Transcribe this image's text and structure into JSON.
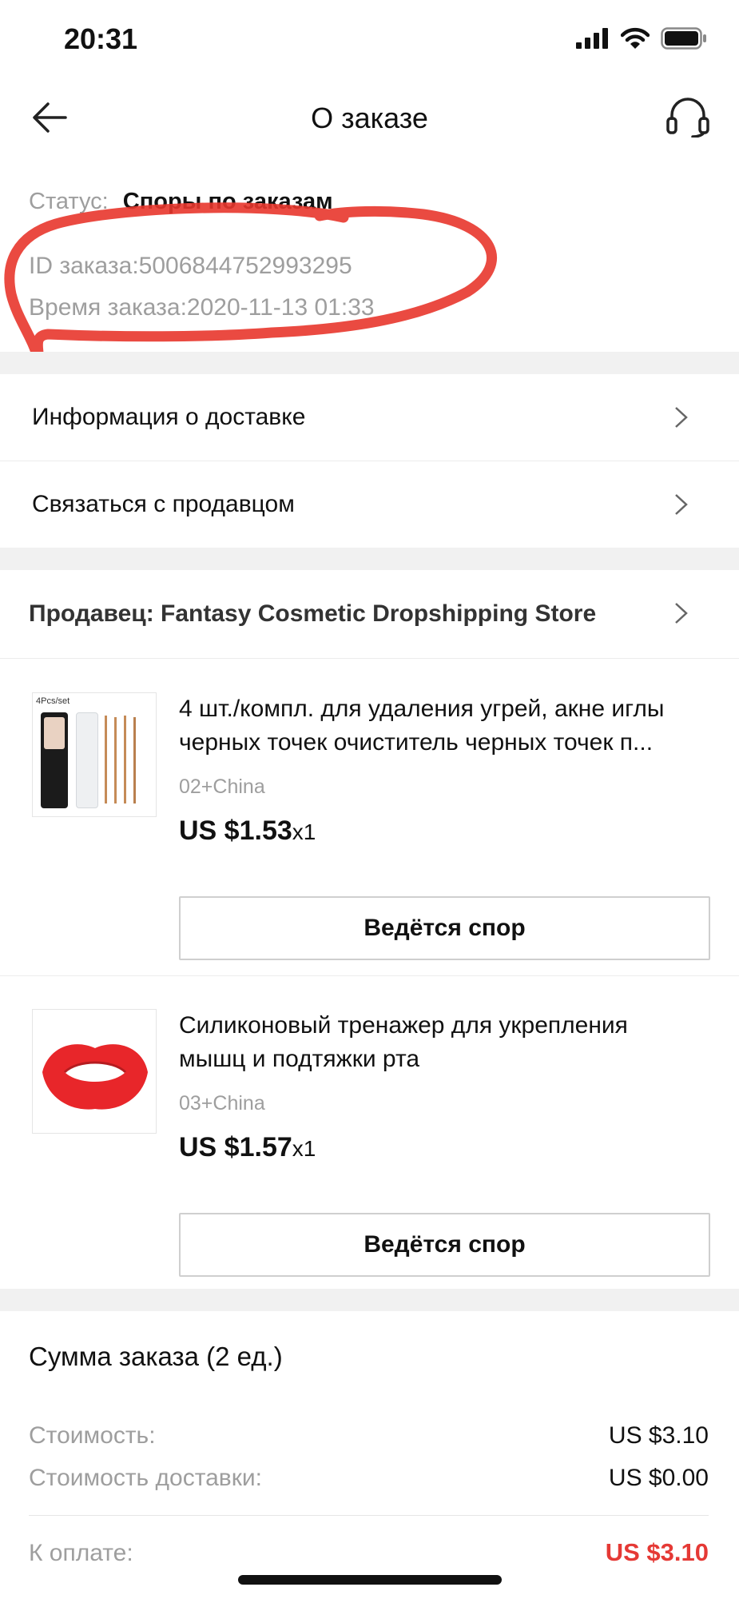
{
  "status_bar": {
    "time": "20:31"
  },
  "header": {
    "title": "О заказе"
  },
  "order": {
    "status_label": "Статус:",
    "status_value": "Споры по заказам",
    "id_text": "ID заказа:5006844752993295",
    "time_text": "Время заказа:2020-11-13 01:33"
  },
  "links": {
    "delivery": "Информация о доставке",
    "contact": "Связаться с продавцом"
  },
  "seller": {
    "label": "Продавец: Fantasy Cosmetic Dropshipping Store"
  },
  "items": [
    {
      "thumb_label": "4Pcs/set",
      "title_line1": "4 шт./компл. для удаления угрей, акне иглы",
      "title_line2": "черных точек очиститель черных точек п...",
      "variant": "02+China",
      "price": "US $1.53",
      "qty": "x1",
      "button": "Ведётся спор"
    },
    {
      "title_line1": "Силиконовый тренажер для укрепления",
      "title_line2": "мышц и подтяжки рта",
      "variant": "03+China",
      "price": "US $1.57",
      "qty": "x1",
      "button": "Ведётся спор"
    }
  ],
  "summary": {
    "title": "Сумма заказа (2 ед.)",
    "cost_label": "Стоимость:",
    "cost_value": "US $3.10",
    "shipping_label": "Стоимость доставки:",
    "shipping_value": "US $0.00",
    "total_label": "К оплате:",
    "total_value": "US $3.10"
  },
  "colors": {
    "accent_red": "#e53935",
    "annotation_red": "#e8362c"
  }
}
